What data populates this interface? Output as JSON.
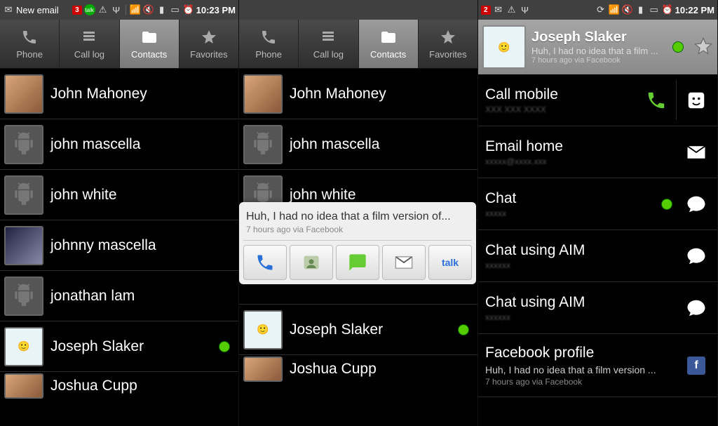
{
  "screens": {
    "s1": {
      "status": {
        "notif_text": "New email",
        "badge": "3",
        "time": "10:23 PM"
      },
      "tabs": [
        "Phone",
        "Call log",
        "Contacts",
        "Favorites"
      ],
      "active_tab": 2,
      "contacts": [
        {
          "name": "John Mahoney",
          "avatar": "photo",
          "presence": false
        },
        {
          "name": "john mascella",
          "avatar": "default",
          "presence": false
        },
        {
          "name": "john white",
          "avatar": "default",
          "presence": false
        },
        {
          "name": "johnny mascella",
          "avatar": "photo2",
          "presence": false
        },
        {
          "name": "jonathan lam",
          "avatar": "default",
          "presence": false
        },
        {
          "name": "Joseph Slaker",
          "avatar": "cartoon",
          "presence": true
        },
        {
          "name": "Joshua Cupp",
          "avatar": "photo",
          "presence": false
        }
      ]
    },
    "s2": {
      "status": {
        "badge": "",
        "time": ""
      },
      "tabs": [
        "Phone",
        "Call log",
        "Contacts",
        "Favorites"
      ],
      "active_tab": 2,
      "contacts": [
        {
          "name": "John Mahoney",
          "avatar": "photo",
          "presence": false
        },
        {
          "name": "john mascella",
          "avatar": "default",
          "presence": false
        },
        {
          "name": "john white",
          "avatar": "default",
          "presence": false
        },
        {
          "name": "Joseph Slaker",
          "avatar": "cartoon",
          "presence": true
        },
        {
          "name": "Joshua Cupp",
          "avatar": "photo",
          "presence": false
        }
      ],
      "popup": {
        "msg": "Huh, I had no idea that a film version of...",
        "meta": "7 hours ago via Facebook",
        "actions": [
          "call",
          "contact",
          "sms",
          "email",
          "talk"
        ]
      }
    },
    "s3": {
      "status": {
        "badge": "2",
        "time": "10:22 PM"
      },
      "header": {
        "name": "Joseph Slaker",
        "msg": "Huh, I had no idea that a film ...",
        "meta": "7 hours ago via Facebook"
      },
      "rows": [
        {
          "title": "Call mobile",
          "sub": "",
          "actions": [
            "call-green",
            "sms"
          ]
        },
        {
          "title": "Email home",
          "sub": "",
          "actions": [
            "mail"
          ]
        },
        {
          "title": "Chat",
          "sub": "",
          "actions": [
            "presence",
            "chat"
          ]
        },
        {
          "title": "Chat using AIM",
          "sub": "",
          "actions": [
            "chat"
          ]
        },
        {
          "title": "Chat using AIM",
          "sub": "",
          "actions": [
            "chat"
          ]
        }
      ],
      "fb": {
        "title": "Facebook profile",
        "msg": "Huh, I had no idea that a film version ...",
        "meta": "7 hours ago via Facebook"
      }
    }
  }
}
